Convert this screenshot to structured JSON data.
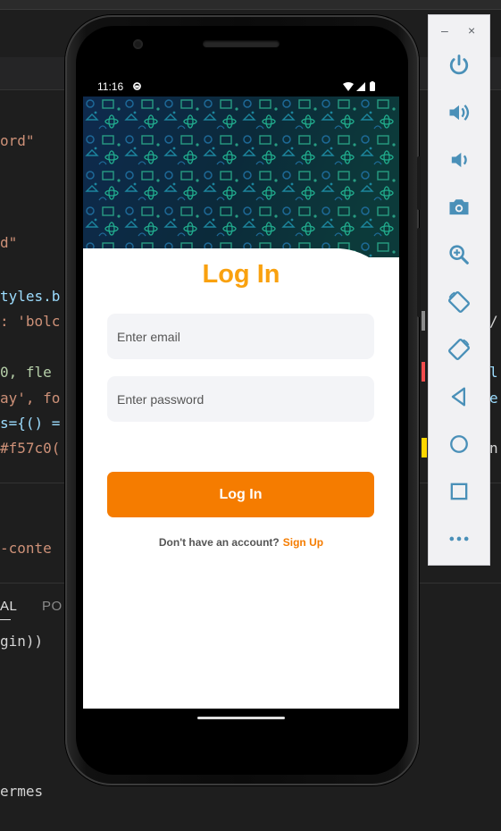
{
  "editor": {
    "code_lines": [
      {
        "text": "ord\""
      },
      {
        "text": "d\""
      },
      {
        "text": "tyles.b"
      },
      {
        "text": ": 'bolc"
      },
      {
        "text": "0, fle"
      },
      {
        "text": "ay', fo"
      },
      {
        "text": "s={() ="
      },
      {
        "text": "#f57c0("
      },
      {
        "text": "-conte"
      },
      {
        "text": "gin))"
      },
      {
        "text": "ermes"
      }
    ],
    "right_code": [
      {
        "text": "/"
      },
      {
        "text": "l"
      },
      {
        "text": "e"
      },
      {
        "text": "n"
      }
    ],
    "panel_tabs": [
      "AL",
      "PO"
    ]
  },
  "device": {
    "status_time": "11:16"
  },
  "login": {
    "title": "Log In",
    "email_placeholder": "Enter email",
    "password_placeholder": "Enter password",
    "login_button": "Log In",
    "no_account_text": "Don't have an account?",
    "signup_link": "Sign Up"
  },
  "emulator_toolbar": {
    "window_controls": [
      "–",
      "×"
    ],
    "buttons": [
      "power-icon",
      "volume-up-icon",
      "volume-down-icon",
      "camera-icon",
      "zoom-icon",
      "rotate-left-icon",
      "rotate-right-icon",
      "back-icon",
      "home-icon",
      "overview-icon",
      "more-icon"
    ]
  },
  "colors": {
    "accent_orange": "#f57c00",
    "title_orange": "#f9a10f",
    "toolbar_icon": "#4a90b8"
  }
}
